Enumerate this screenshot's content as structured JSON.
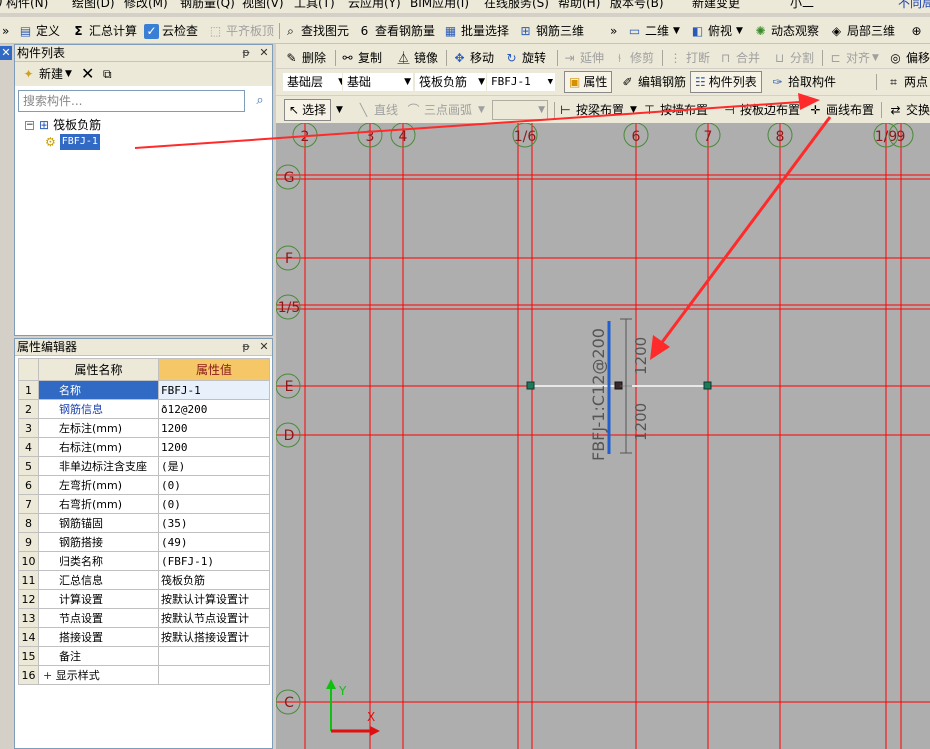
{
  "menu": [
    "构件(N)",
    "绘图(D)",
    "修改(M)",
    "钢筋量(Q)",
    "视图(V)",
    "工具(T)",
    "云应用(Y)",
    "BIM应用(I)",
    "在线服务(S)",
    "帮助(H)",
    "版本号(B)",
    "新建变更",
    "小二",
    "不同局"
  ],
  "toolbar1": {
    "chevron": "»",
    "define": "定义",
    "sum_calc": "汇总计算",
    "cloud_check": "云检查",
    "flat_top": "平齐板顶",
    "find_elem": "查找图元",
    "view_rebar": "查看钢筋量",
    "batch_select": "批量选择",
    "rebar_3d": "钢筋三维",
    "chevron2": "»",
    "view_2d": "二维",
    "top_view": "俯视",
    "dynamic_view": "动态观察",
    "local_3d": "局部三维"
  },
  "component_list": {
    "title": "构件列表",
    "new_label": "新建",
    "search_placeholder": "搜索构件...",
    "tree_root": "筏板负筋",
    "tree_child": "FBFJ-1"
  },
  "property_editor": {
    "title": "属性编辑器",
    "col_name": "属性名称",
    "col_value": "属性值",
    "rows": [
      {
        "num": "1",
        "name": "名称",
        "value": "FBFJ-1"
      },
      {
        "num": "2",
        "name": "钢筋信息",
        "value": "ð12@200"
      },
      {
        "num": "3",
        "name": "左标注(mm)",
        "value": "1200"
      },
      {
        "num": "4",
        "name": "右标注(mm)",
        "value": "1200"
      },
      {
        "num": "5",
        "name": "非单边标注含支座",
        "value": "(是)"
      },
      {
        "num": "6",
        "name": "左弯折(mm)",
        "value": "(0)"
      },
      {
        "num": "7",
        "name": "右弯折(mm)",
        "value": "(0)"
      },
      {
        "num": "8",
        "name": "钢筋锚固",
        "value": "(35)"
      },
      {
        "num": "9",
        "name": "钢筋搭接",
        "value": "(49)"
      },
      {
        "num": "10",
        "name": "归类名称",
        "value": "(FBFJ-1)"
      },
      {
        "num": "11",
        "name": "汇总信息",
        "value": "筏板负筋"
      },
      {
        "num": "12",
        "name": "计算设置",
        "value": "按默认计算设置计"
      },
      {
        "num": "13",
        "name": "节点设置",
        "value": "按默认节点设置计"
      },
      {
        "num": "14",
        "name": "搭接设置",
        "value": "按默认搭接设置计"
      },
      {
        "num": "15",
        "name": "备注",
        "value": ""
      },
      {
        "num": "16",
        "name": "显示样式",
        "value": ""
      }
    ]
  },
  "toolbar2": {
    "delete": "删除",
    "copy": "复制",
    "mirror": "镜像",
    "move": "移动",
    "rotate": "旋转",
    "extend": "延伸",
    "trim": "修剪",
    "break": "打断",
    "merge": "合并",
    "split": "分割",
    "align": "对齐",
    "offset": "偏移"
  },
  "toolbar3": {
    "layer": "基础层",
    "category": "基础",
    "type": "筏板负筋",
    "component": "FBFJ-1",
    "properties": "属性",
    "edit_rebar": "编辑钢筋",
    "component_list": "构件列表",
    "pick_component": "拾取构件",
    "two_point": "两点"
  },
  "toolbar4": {
    "select": "选择",
    "line": "直线",
    "arc": "三点画弧",
    "by_beam": "按梁布置",
    "by_wall": "按墙布置",
    "by_slab_edge": "按板边布置",
    "draw_line": "画线布置",
    "swap": "交换"
  },
  "canvas": {
    "x_axes": [
      "2",
      "3",
      "4",
      "1/6",
      "6",
      "7",
      "8",
      "1/9",
      "9"
    ],
    "y_axes": [
      "G",
      "F",
      "1/5",
      "E",
      "D",
      "C"
    ],
    "rebar_label": "FBFJ-1:C12@200",
    "left_dim": "1200",
    "right_dim": "1200",
    "ucs_x": "X",
    "ucs_y": "Y"
  },
  "colors": {
    "canvas_bg": "#aeaeae",
    "grid": "#ff0000",
    "axis_circle": "#4a8a3a",
    "arrow": "#ff2a2a",
    "highlight": "#316ac5"
  }
}
